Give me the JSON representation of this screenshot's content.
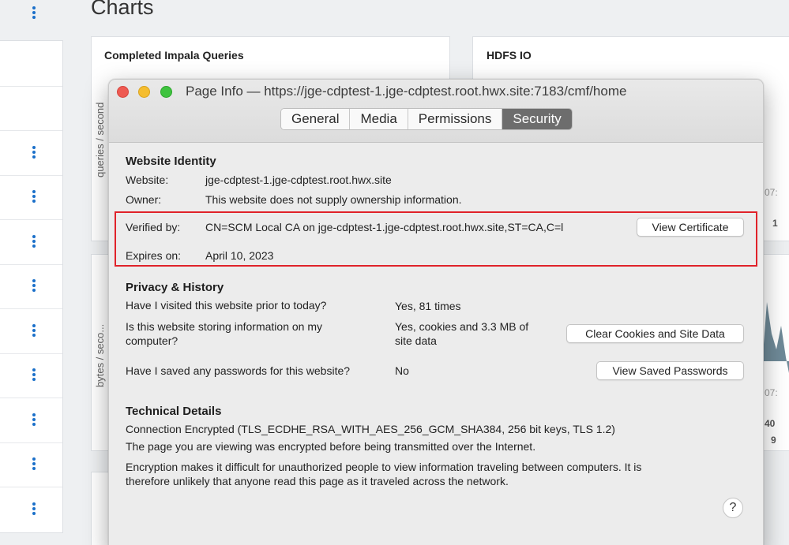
{
  "background": {
    "page_title": "Charts",
    "cards": {
      "impala_title": "Completed Impala Queries",
      "hdfs_title": "HDFS IO",
      "impala_axis": "queries / second",
      "bytes_axis": "bytes / seco..."
    },
    "right_fragments": [
      "07:",
      "1",
      "07:",
      "40",
      "9"
    ]
  },
  "dialog": {
    "window_title": "Page Info — https://jge-cdptest-1.jge-cdptest.root.hwx.site:7183/cmf/home",
    "tabs": [
      {
        "label": "General",
        "active": false
      },
      {
        "label": "Media",
        "active": false
      },
      {
        "label": "Permissions",
        "active": false
      },
      {
        "label": "Security",
        "active": true
      }
    ],
    "identity": {
      "heading": "Website Identity",
      "website_label": "Website:",
      "website_value": "jge-cdptest-1.jge-cdptest.root.hwx.site",
      "owner_label": "Owner:",
      "owner_value": "This website does not supply ownership information.",
      "verified_label": "Verified by:",
      "verified_value": "CN=SCM Local CA on jge-cdptest-1.jge-cdptest.root.hwx.site,ST=CA,C=l",
      "view_cert_button": "View Certificate",
      "expires_label": "Expires on:",
      "expires_value": "April 10, 2023"
    },
    "privacy": {
      "heading": "Privacy & History",
      "q_visited": "Have I visited this website prior to today?",
      "a_visited": "Yes, 81 times",
      "q_storing_line1": "Is this website storing information on my",
      "q_storing_line2": "computer?",
      "a_storing_line1": "Yes, cookies and 3.3 MB of",
      "a_storing_line2": "site data",
      "clear_button": "Clear Cookies and Site Data",
      "q_passwords": "Have I saved any passwords for this website?",
      "a_passwords": "No",
      "passwords_button": "View Saved Passwords"
    },
    "technical": {
      "heading": "Technical Details",
      "line1": "Connection Encrypted (TLS_ECDHE_RSA_WITH_AES_256_GCM_SHA384, 256 bit keys, TLS 1.2)",
      "line2": "The page you are viewing was encrypted before being transmitted over the Internet.",
      "line3": "Encryption makes it difficult for unauthorized people to view information traveling between computers. It is",
      "line4": "therefore unlikely that anyone read this page as it traveled across the network."
    },
    "help_glyph": "?"
  },
  "colors": {
    "highlight_border": "#e0222a",
    "active_tab": "#6d6d6d",
    "kebab_icon": "#1a6fc9"
  }
}
